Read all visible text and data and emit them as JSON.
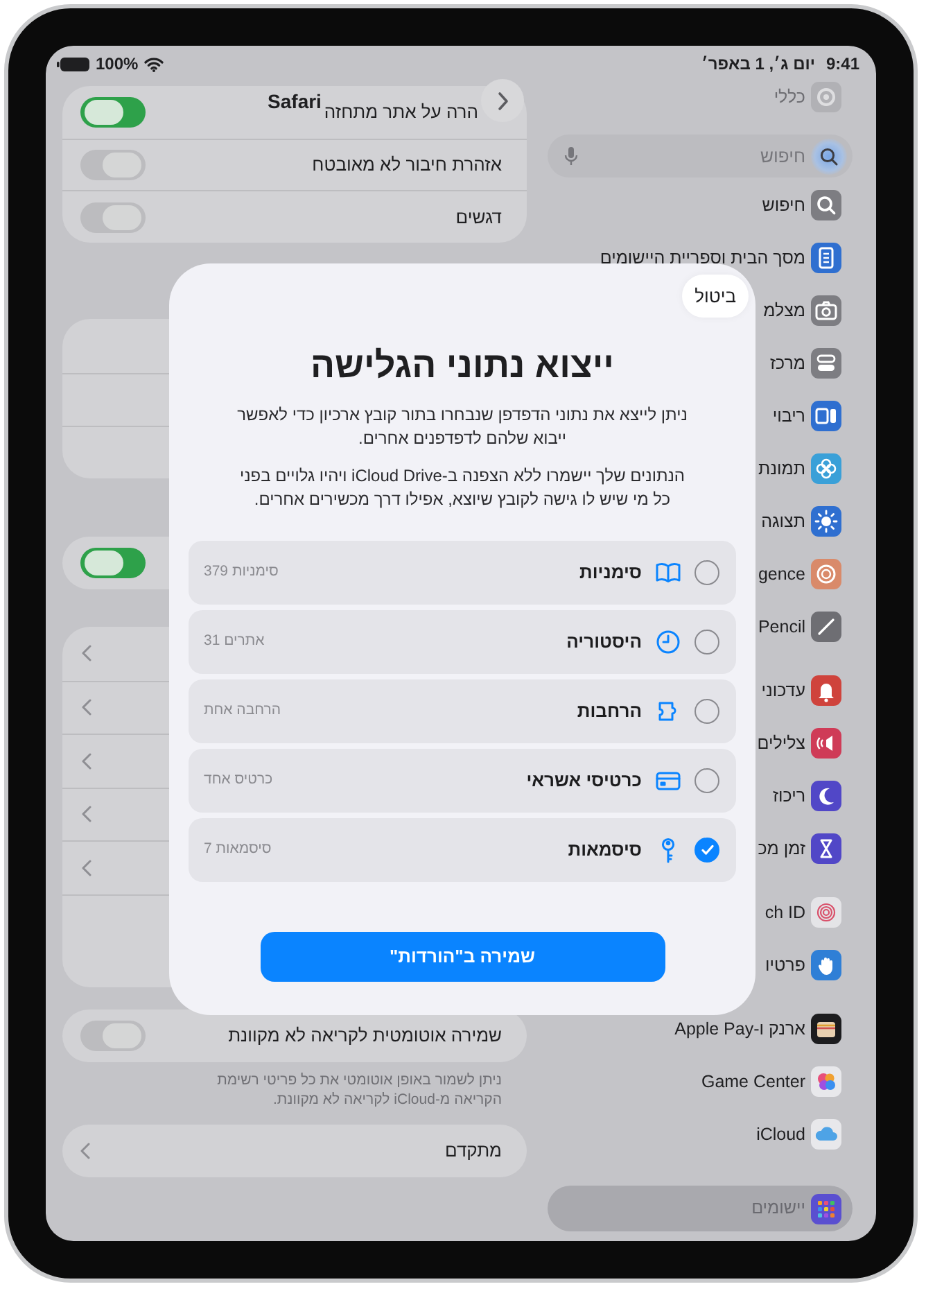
{
  "status_bar": {
    "time": "9:41",
    "date": "יום ג׳, 1 באפר׳",
    "battery": "100%"
  },
  "settings_pane": {
    "title": "Safari",
    "security_rows": [
      {
        "label": "הרה על אתר מתחזה",
        "on": true
      },
      {
        "label": "אזהרת חיבור לא מאובטח",
        "on": false
      },
      {
        "label": "דגשים",
        "on": false
      }
    ],
    "obscured_toggle": {
      "on": true
    },
    "reading_list": {
      "label": "שמירה אוטומטית לקריאה לא מקוונת",
      "on": false
    },
    "reading_list_note": "ניתן לשמור באופן אוטומטי את כל פריטי רשימת הקריאה מ-iCloud לקריאה לא מקוונת.",
    "advanced": "מתקדם"
  },
  "sidebar": {
    "faded_item": {
      "label": "כללי",
      "kind": "general"
    },
    "search": {
      "placeholder": "חיפוש"
    },
    "groups": [
      [
        {
          "label": "חיפוש",
          "kind": "search",
          "selected": false
        },
        {
          "label": "מסך הבית וספריית היישומים",
          "kind": "home",
          "selected": false
        },
        {
          "label": "מצלמ",
          "kind": "camera",
          "selected": false
        },
        {
          "label": "מרכז",
          "kind": "control",
          "selected": false
        },
        {
          "label": "ריבוי",
          "kind": "multitask",
          "selected": false
        },
        {
          "label": "תמונת",
          "kind": "wallpaper",
          "selected": false
        },
        {
          "label": "תצוגה",
          "kind": "display",
          "selected": false
        },
        {
          "label": "gence",
          "kind": "intelligence",
          "selected": false
        },
        {
          "label": "Pencil",
          "kind": "pencil",
          "selected": false
        }
      ],
      [
        {
          "label": "עדכוני",
          "kind": "notifications",
          "selected": false
        },
        {
          "label": "צלילים",
          "kind": "sounds",
          "selected": false
        },
        {
          "label": "ריכוז",
          "kind": "focus",
          "selected": false
        },
        {
          "label": "זמן מכ",
          "kind": "screentime",
          "selected": false
        }
      ],
      [
        {
          "label": "ch ID",
          "kind": "touchid",
          "selected": false
        },
        {
          "label": "פרטיו",
          "kind": "privacy",
          "selected": false
        }
      ],
      [
        {
          "label": "ארנק ו-Apple Pay",
          "kind": "wallet",
          "selected": false
        },
        {
          "label": "Game Center",
          "kind": "gamecenter",
          "selected": false
        },
        {
          "label": "iCloud",
          "kind": "icloud",
          "selected": false
        }
      ],
      [
        {
          "label": "יישומים",
          "kind": "apps",
          "selected": true
        }
      ]
    ]
  },
  "dialog": {
    "cancel": "ביטול",
    "title": "ייצוא נתוני הגלישה",
    "paragraphs": [
      "ניתן לייצא את נתוני הדפדפן שנבחרו בתור קובץ ארכיון כדי לאפשר ייבוא שלהם לדפדפנים אחרים.",
      "הנתונים שלך יישמרו ללא הצפנה ב-iCloud Drive ויהיו גלויים בפני כל מי שיש לו גישה לקובץ שיוצא, אפילו דרך מכשירים אחרים."
    ],
    "items": [
      {
        "kind": "bookmarks",
        "label": "סימניות",
        "count": "379 סימניות",
        "checked": false
      },
      {
        "kind": "history",
        "label": "היסטוריה",
        "count": "31 אתרים",
        "checked": false
      },
      {
        "kind": "extensions",
        "label": "הרחבות",
        "count": "הרחבה אחת",
        "checked": false
      },
      {
        "kind": "cards",
        "label": "כרטיסי אשראי",
        "count": "כרטיס אחד",
        "checked": false
      },
      {
        "kind": "passwords",
        "label": "סיסמאות",
        "count": "7 סיסמאות",
        "checked": true
      }
    ],
    "save": "שמירה ב\"הורדות\""
  }
}
